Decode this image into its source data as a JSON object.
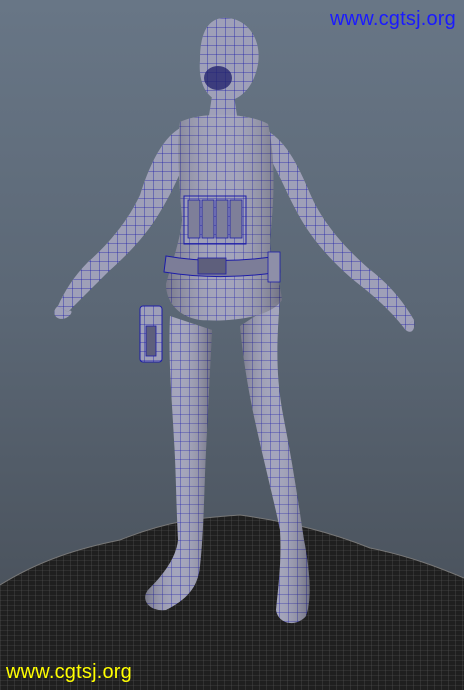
{
  "watermarks": {
    "top_text": "www.cgtsj.org",
    "bottom_text": "www.cgtsj.org",
    "top_color": "#1a1aff",
    "bottom_color": "#ffff00"
  },
  "colors": {
    "background_top": "#687686",
    "background_bottom": "#454c55",
    "model_shade": "#9fa0b8",
    "wireframe": "#1c1ca8",
    "ground": "#202020",
    "ground_wire": "#5a5a5a"
  }
}
